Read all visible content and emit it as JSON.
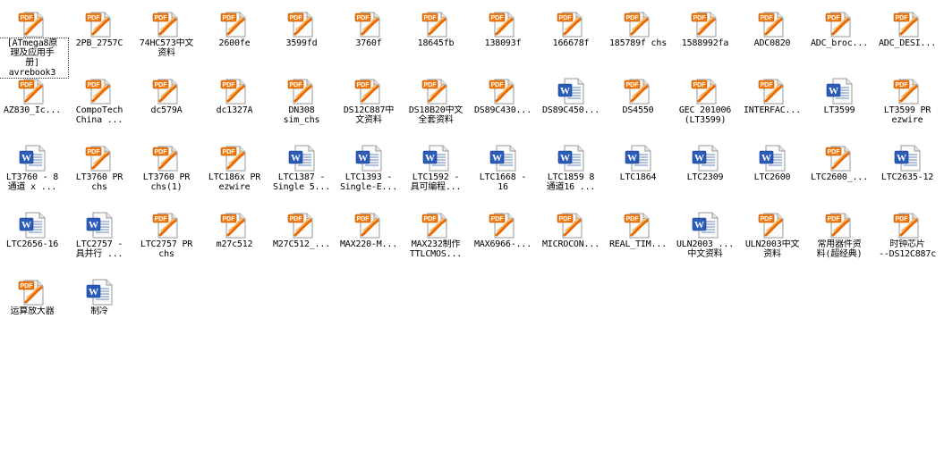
{
  "desktop": {
    "items": [
      {
        "label": "[ATmega8原\n理及应用手\n册]\navrebook3",
        "type": "pdf",
        "selected": true
      },
      {
        "label": "2PB_2757C",
        "type": "pdf"
      },
      {
        "label": "74HC573中文\n资料",
        "type": "pdf"
      },
      {
        "label": "2600fe",
        "type": "pdf"
      },
      {
        "label": "3599fd",
        "type": "pdf"
      },
      {
        "label": "3760f",
        "type": "pdf"
      },
      {
        "label": "18645fb",
        "type": "pdf"
      },
      {
        "label": "138093f",
        "type": "pdf"
      },
      {
        "label": "166678f",
        "type": "pdf"
      },
      {
        "label": "185789f chs",
        "type": "pdf"
      },
      {
        "label": "1588992fa",
        "type": "pdf"
      },
      {
        "label": "ADC0820",
        "type": "pdf"
      },
      {
        "label": "ADC_broc...",
        "type": "pdf"
      },
      {
        "label": "ADC_DESI...",
        "type": "pdf"
      },
      {
        "label": "AZ830_Ic...",
        "type": "pdf"
      },
      {
        "label": "CompoTech\nChina ...",
        "type": "pdf"
      },
      {
        "label": "dc579A",
        "type": "pdf"
      },
      {
        "label": "dc1327A",
        "type": "pdf"
      },
      {
        "label": "DN308\nsim_chs",
        "type": "pdf"
      },
      {
        "label": "DS12C887中\n文资料",
        "type": "pdf"
      },
      {
        "label": "DS18B20中文\n全套资料",
        "type": "pdf"
      },
      {
        "label": "DS89C430...",
        "type": "pdf"
      },
      {
        "label": "DS89C450...",
        "type": "word"
      },
      {
        "label": "DS4550",
        "type": "pdf"
      },
      {
        "label": "GEC 201006\n(LT3599)",
        "type": "pdf"
      },
      {
        "label": "INTERFAC...",
        "type": "pdf"
      },
      {
        "label": "LT3599",
        "type": "word"
      },
      {
        "label": "LT3599 PR\nezwire",
        "type": "pdf"
      },
      {
        "label": "LT3760 - 8\n通道 x ...",
        "type": "word"
      },
      {
        "label": "LT3760 PR\nchs",
        "type": "pdf"
      },
      {
        "label": "LT3760 PR\nchs(1)",
        "type": "pdf"
      },
      {
        "label": "LTC186x PR\nezwire",
        "type": "pdf"
      },
      {
        "label": "LTC1387 -\nSingle 5...",
        "type": "word"
      },
      {
        "label": "LTC1393 -\nSingle-E...",
        "type": "word"
      },
      {
        "label": "LTC1592 -\n具可编程...",
        "type": "word"
      },
      {
        "label": "LTC1668 -\n16",
        "type": "word"
      },
      {
        "label": "LTC1859  8\n通道16 ...",
        "type": "word"
      },
      {
        "label": "LTC1864",
        "type": "word"
      },
      {
        "label": "LTC2309",
        "type": "word"
      },
      {
        "label": "LTC2600",
        "type": "word"
      },
      {
        "label": "LTC2600_...",
        "type": "pdf"
      },
      {
        "label": "LTC2635-12",
        "type": "word"
      },
      {
        "label": "LTC2656-16",
        "type": "word"
      },
      {
        "label": "LTC2757 -\n具并行 ...",
        "type": "word"
      },
      {
        "label": "LTC2757 PR\nchs",
        "type": "pdf"
      },
      {
        "label": "m27c512",
        "type": "pdf"
      },
      {
        "label": "M27C512_...",
        "type": "pdf"
      },
      {
        "label": "MAX220-M...",
        "type": "pdf"
      },
      {
        "label": "MAX232制作\nTTLCMOS...",
        "type": "pdf"
      },
      {
        "label": "MAX6966-...",
        "type": "pdf"
      },
      {
        "label": "MICROCON...",
        "type": "pdf"
      },
      {
        "label": "REAL_TIM...",
        "type": "pdf"
      },
      {
        "label": "ULN2003_...\n中文资料",
        "type": "word"
      },
      {
        "label": "ULN2003中文\n资料",
        "type": "pdf"
      },
      {
        "label": "常用器件资\n料(超经典)",
        "type": "pdf"
      },
      {
        "label": "时钟芯片\n--DS12C887c",
        "type": "pdf"
      },
      {
        "label": "运算放大器",
        "type": "pdf"
      },
      {
        "label": "制冷",
        "type": "word"
      }
    ],
    "icon_text": {
      "pdf": "PDF",
      "word": "W"
    },
    "colors": {
      "pdf_badge": "#f07a10",
      "pdf_swoosh": "#e86a00",
      "word_blue": "#2a5cb8"
    }
  }
}
